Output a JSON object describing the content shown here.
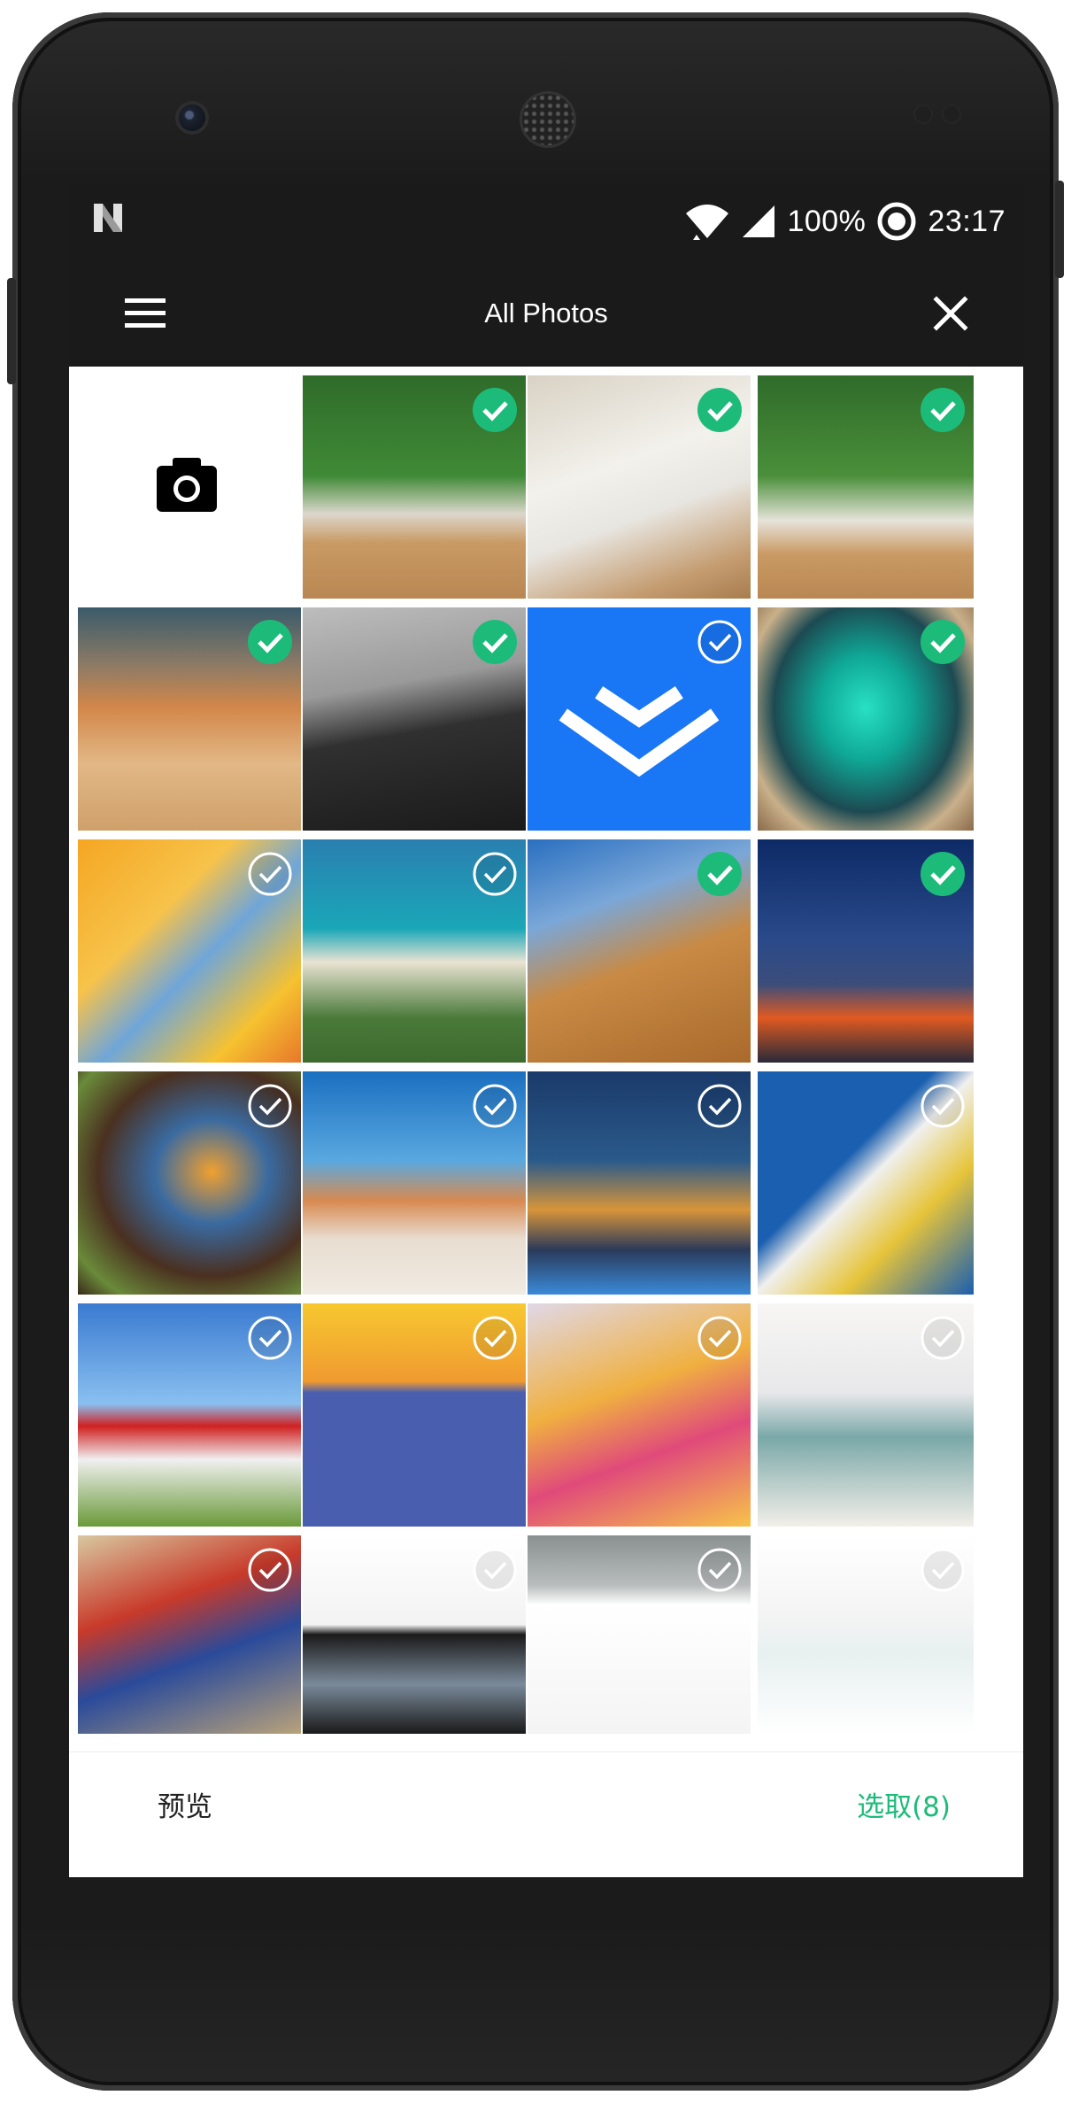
{
  "status_bar": {
    "logo_icon": "n-logo-icon",
    "battery": "100%",
    "time": "23:17"
  },
  "toolbar": {
    "menu_icon": "hamburger-menu-icon",
    "title": "All Photos",
    "close_icon": "close-icon"
  },
  "grid": {
    "camera_icon": "camera-icon",
    "photos": [
      {
        "name": "photo-plant-desk",
        "selected": true
      },
      {
        "name": "photo-phone-notebook",
        "selected": true
      },
      {
        "name": "photo-plant-desk-2",
        "selected": true
      },
      {
        "name": "photo-lunch-box",
        "selected": true
      },
      {
        "name": "photo-laptop-keyboard",
        "selected": true
      },
      {
        "name": "photo-blue-app-icon",
        "selected": false
      },
      {
        "name": "photo-sea-cave",
        "selected": true
      },
      {
        "name": "photo-orange-popsicles",
        "selected": false
      },
      {
        "name": "photo-coastal-cliffs",
        "selected": false
      },
      {
        "name": "photo-ancient-columns",
        "selected": true
      },
      {
        "name": "photo-tent-campfire",
        "selected": true
      },
      {
        "name": "photo-cave-sunset",
        "selected": false
      },
      {
        "name": "photo-desert-tree",
        "selected": false
      },
      {
        "name": "photo-london-night",
        "selected": false
      },
      {
        "name": "photo-pelican",
        "selected": false
      },
      {
        "name": "photo-red-poppy",
        "selected": false
      },
      {
        "name": "photo-app-screenshot",
        "selected": false
      },
      {
        "name": "photo-never-settle",
        "selected": false
      },
      {
        "name": "photo-anime-character",
        "selected": false
      },
      {
        "name": "photo-superman-comic",
        "selected": false
      },
      {
        "name": "photo-weibo-post",
        "selected": false
      },
      {
        "name": "photo-forum-screenshot",
        "selected": false
      },
      {
        "name": "photo-stats-screenshot",
        "selected": false
      }
    ]
  },
  "bottom_bar": {
    "preview_label": "预览",
    "select_label": "选取(8)"
  },
  "colors": {
    "accent_green": "#1dbb7a",
    "bar_dark": "#1a1a1a"
  }
}
